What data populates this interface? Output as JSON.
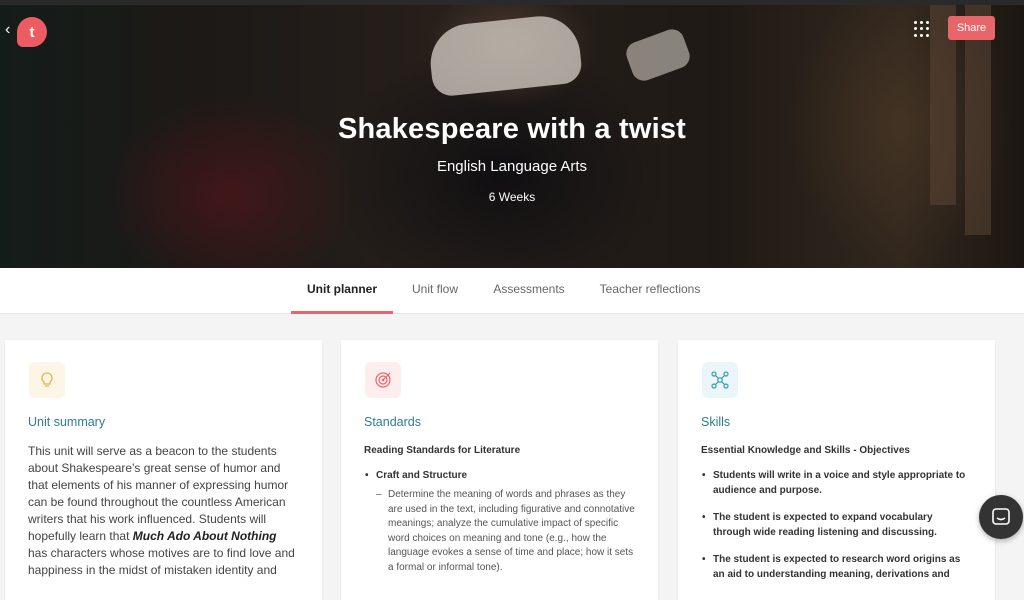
{
  "header": {
    "back_icon": "chevron-left-icon",
    "logo_letter": "t",
    "apps_icon": "grid-icon",
    "share_label": "Share"
  },
  "hero": {
    "title": "Shakespeare with a twist",
    "subject": "English Language Arts",
    "duration": "6 Weeks"
  },
  "tabs": [
    {
      "label": "Unit planner",
      "active": true
    },
    {
      "label": "Unit flow",
      "active": false
    },
    {
      "label": "Assessments",
      "active": false
    },
    {
      "label": "Teacher reflections",
      "active": false
    }
  ],
  "cards": {
    "summary": {
      "icon": "lightbulb-icon",
      "title": "Unit summary",
      "text_before": "This unit will serve as a beacon to the students about Shakespeare's great sense of humor and that elements of his manner of expressing humor can be found throughout the countless American writers that his work influenced. Students will hopefully learn that ",
      "text_emphasis": "Much Ado About Nothing",
      "text_after": " has characters whose motives are to find love and happiness in the midst of mistaken identity and"
    },
    "standards": {
      "icon": "target-icon",
      "title": "Standards",
      "heading": "Reading Standards for Literature",
      "bullet": "Craft and Structure",
      "sub_dash": "–",
      "sub_text": "Determine the meaning of words and phrases as they are used in the text, including figurative and connotative meanings; analyze the cumulative impact of specific word choices on meaning and tone (e.g., how the language evokes a sense of time and place; how it sets a formal or informal tone)."
    },
    "skills": {
      "icon": "network-icon",
      "title": "Skills",
      "heading": "Essential Knowledge and Skills - Objectives",
      "bullets": [
        "Students will write in a voice and style appropriate to audience and purpose.",
        "The student is expected to expand vocabulary through wide reading listening and discussing.",
        "The student is expected to research word origins as an aid to understanding meaning, derivations and"
      ]
    }
  },
  "chat_icon": "chat-bubble-icon",
  "colors": {
    "accent": "#e8666a",
    "card_title": "#2f7d8f",
    "summary_icon_bg": "#fdf5e6",
    "standards_icon_bg": "#fdeeee",
    "skills_icon_bg": "#eaf6f9"
  }
}
